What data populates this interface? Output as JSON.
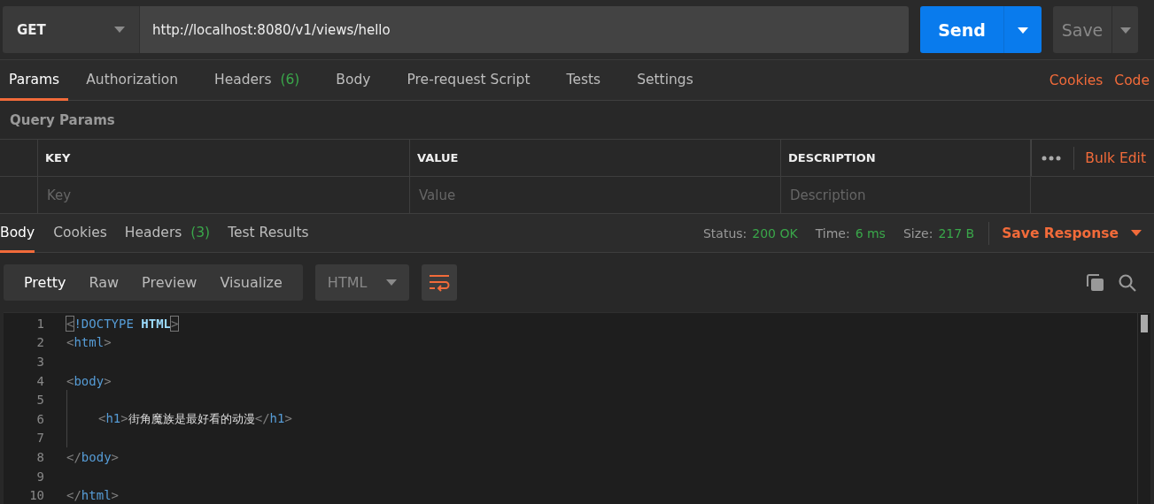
{
  "request": {
    "method": "GET",
    "url": "http://localhost:8080/v1/views/hello",
    "send": "Send",
    "save": "Save"
  },
  "request_tabs": [
    {
      "label": "Params",
      "selected": true
    },
    {
      "label": "Authorization",
      "selected": false
    },
    {
      "label": "Headers",
      "count": "(6)",
      "selected": false
    },
    {
      "label": "Body",
      "selected": false
    },
    {
      "label": "Pre-request Script",
      "selected": false
    },
    {
      "label": "Tests",
      "selected": false
    },
    {
      "label": "Settings",
      "selected": false
    }
  ],
  "request_links": [
    "Cookies",
    "Code"
  ],
  "query_params": {
    "title": "Query Params",
    "columns": [
      "KEY",
      "VALUE",
      "DESCRIPTION"
    ],
    "bulk_edit": "Bulk Edit",
    "placeholders": [
      "Key",
      "Value",
      "Description"
    ]
  },
  "response_tabs": [
    {
      "label": "Body",
      "selected": true
    },
    {
      "label": "Cookies",
      "selected": false
    },
    {
      "label": "Headers",
      "count": "(3)",
      "selected": false
    },
    {
      "label": "Test Results",
      "selected": false
    }
  ],
  "response_meta": [
    {
      "label": "Status:",
      "value": "200 OK"
    },
    {
      "label": "Time:",
      "value": "6 ms"
    },
    {
      "label": "Size:",
      "value": "217 B"
    }
  ],
  "save_response": "Save Response",
  "view_modes": [
    {
      "label": "Pretty",
      "selected": true
    },
    {
      "label": "Raw",
      "selected": false
    },
    {
      "label": "Preview",
      "selected": false
    },
    {
      "label": "Visualize",
      "selected": false
    }
  ],
  "format": "HTML",
  "wrap_on": true,
  "code_lines": [
    {
      "number": "1",
      "tokens": [
        {
          "kind": "match",
          "text": "<"
        },
        {
          "kind": "keyword",
          "text": "!DOCTYPE"
        },
        {
          "kind": "strong",
          "text": " HTML"
        },
        {
          "kind": "match",
          "text": ">"
        }
      ]
    },
    {
      "number": "2",
      "tokens": [
        {
          "kind": "punct",
          "text": "<"
        },
        {
          "kind": "tag",
          "text": "html"
        },
        {
          "kind": "punct",
          "text": ">"
        }
      ]
    },
    {
      "number": "3"
    },
    {
      "number": "4",
      "tokens": [
        {
          "kind": "punct",
          "text": "<"
        },
        {
          "kind": "tag",
          "text": "body"
        },
        {
          "kind": "punct",
          "text": ">"
        }
      ]
    },
    {
      "number": "5",
      "guide": true
    },
    {
      "number": "6",
      "guide": true,
      "indented": true,
      "tokens": [
        {
          "kind": "punct",
          "text": "<"
        },
        {
          "kind": "tag",
          "text": "h1"
        },
        {
          "kind": "punct",
          "text": ">"
        },
        {
          "kind": "text",
          "text": "街角魔族是最好看的动漫"
        },
        {
          "kind": "punct",
          "text": "</"
        },
        {
          "kind": "tag",
          "text": "h1"
        },
        {
          "kind": "punct",
          "text": ">"
        }
      ]
    },
    {
      "number": "7",
      "guide": true
    },
    {
      "number": "8",
      "tokens": [
        {
          "kind": "punct",
          "text": "</"
        },
        {
          "kind": "tag",
          "text": "body"
        },
        {
          "kind": "punct",
          "text": ">"
        }
      ]
    },
    {
      "number": "9"
    },
    {
      "number": "10",
      "tokens": [
        {
          "kind": "punct",
          "text": "</"
        },
        {
          "kind": "tag",
          "text": "html"
        },
        {
          "kind": "punct",
          "text": ">"
        }
      ]
    }
  ]
}
